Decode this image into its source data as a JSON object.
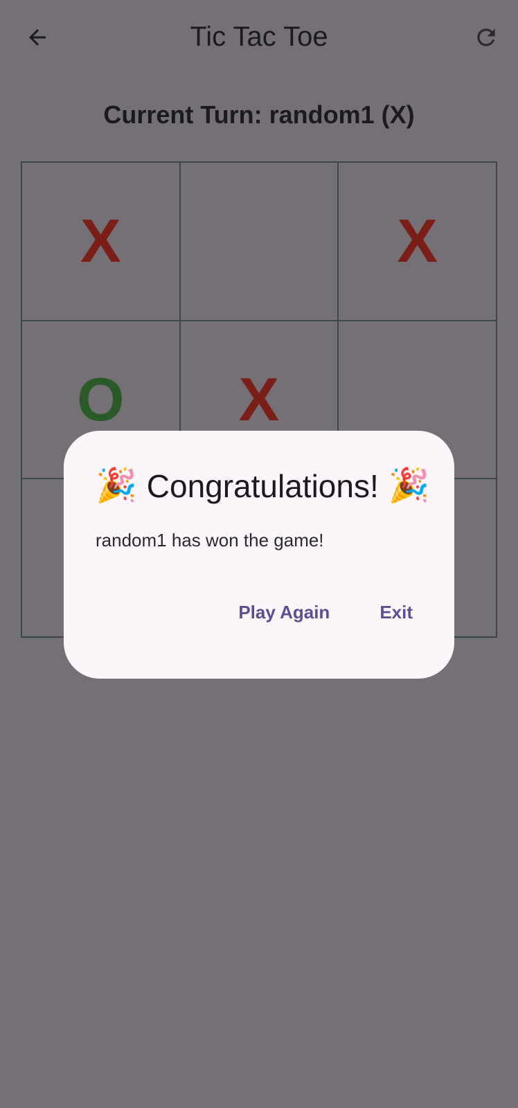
{
  "appbar": {
    "title": "Tic Tac Toe",
    "back_icon": "arrow-left-icon",
    "refresh_icon": "refresh-icon"
  },
  "turn_text": "Current Turn: random1 (X)",
  "board": {
    "cells": [
      "X",
      "",
      "X",
      "O",
      "X",
      "",
      "",
      "",
      ""
    ]
  },
  "dialog": {
    "emoji": "🎉",
    "title": "Congratulations!",
    "message": "random1 has won the game!",
    "play_again": "Play Again",
    "exit": "Exit"
  },
  "colors": {
    "x": "#7a1f17",
    "o": "#2a5a28",
    "accent": "#5e4d93",
    "grid": "#3b464d"
  }
}
